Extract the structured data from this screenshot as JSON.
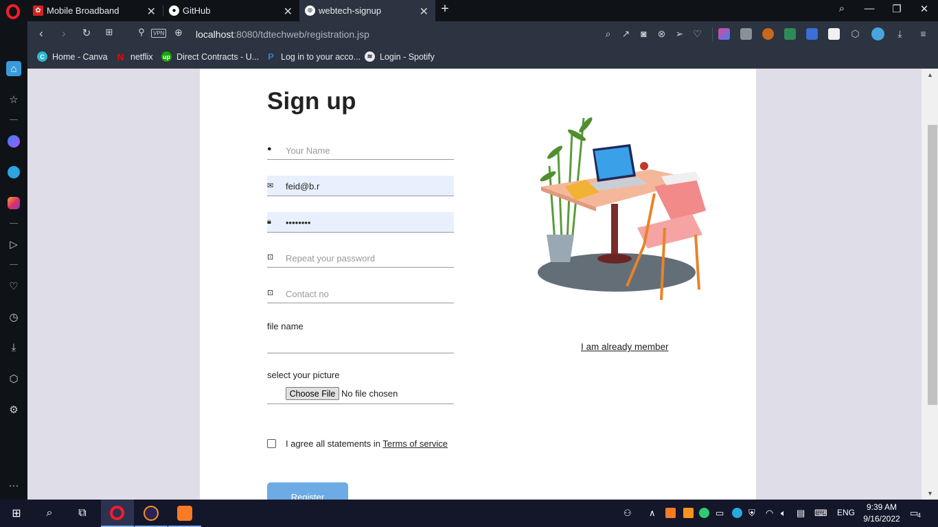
{
  "browser": {
    "tabs": [
      {
        "title": "Mobile Broadband",
        "active": false
      },
      {
        "title": "GitHub",
        "active": false
      },
      {
        "title": "webtech-signup",
        "active": true
      }
    ],
    "url_host": "localhost",
    "url_path": ":8080/tdtechweb/registration.jsp",
    "vpn_label": "VPN",
    "bookmarks": [
      {
        "label": "Home - Canva",
        "icon": "canva-icon"
      },
      {
        "label": "netflix",
        "icon": "netflix-icon"
      },
      {
        "label": "Direct Contracts - U...",
        "icon": "upwork-icon"
      },
      {
        "label": "Log in to your acco...",
        "icon": "paypal-icon"
      },
      {
        "label": "Login - Spotify",
        "icon": "spotify-icon"
      }
    ]
  },
  "form": {
    "title": "Sign up",
    "name_placeholder": "Your Name",
    "email_value": "feid@b.r",
    "password_value": "••••••••",
    "repeat_password_placeholder": "Repeat your password",
    "contact_placeholder": "Contact no",
    "file_name_label": "file name",
    "select_picture_label": "select your picture",
    "choose_file_label": "Choose File",
    "no_file_text": "No file chosen",
    "agree_text": "I agree all statements in ",
    "terms_link": "Terms of service",
    "register_label": "Register",
    "member_link": "I am already member"
  },
  "taskbar": {
    "lang": "ENG",
    "time": "9:39 AM",
    "date": "9/16/2022",
    "notification_count": "4"
  },
  "colors": {
    "accent_button": "#6dabe4",
    "page_bg": "#dedde8",
    "autofill_bg": "#e8f0fe"
  }
}
